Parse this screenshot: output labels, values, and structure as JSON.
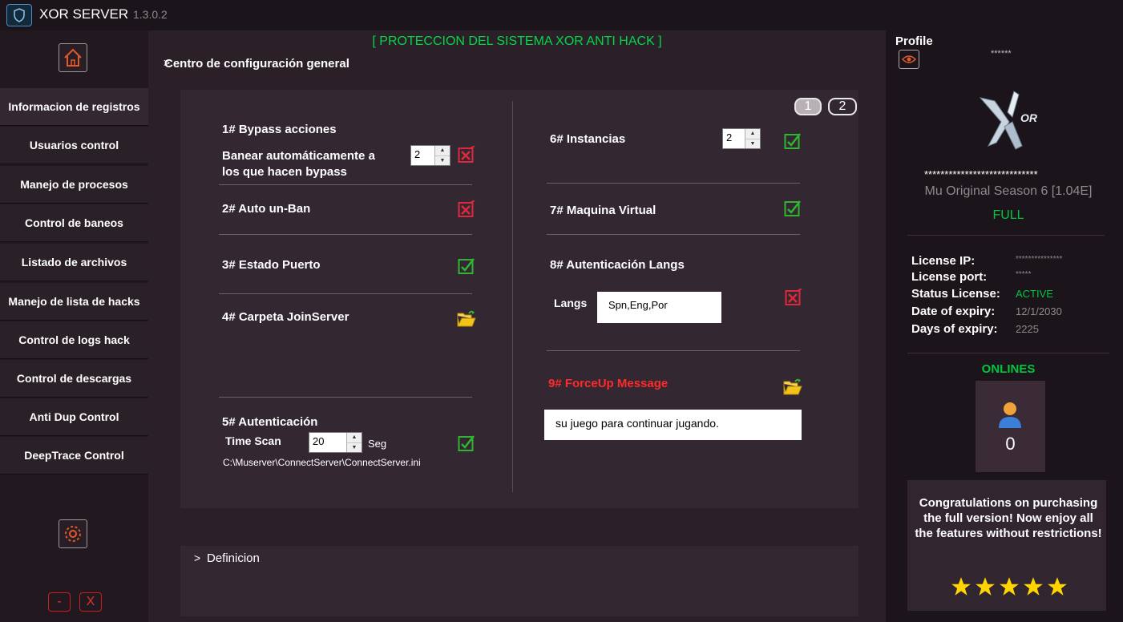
{
  "app": {
    "title": "XOR SERVER",
    "version": "1.3.0.2"
  },
  "sidebar": {
    "items": [
      {
        "label": "Informacion de registros"
      },
      {
        "label": "Usuarios control"
      },
      {
        "label": "Manejo de procesos"
      },
      {
        "label": "Control de baneos"
      },
      {
        "label": "Listado de archivos"
      },
      {
        "label": "Manejo de lista de hacks"
      },
      {
        "label": "Control de logs hack"
      },
      {
        "label": "Control de descargas"
      },
      {
        "label": "Anti Dup Control"
      },
      {
        "label": "DeepTrace Control"
      }
    ],
    "minimize_label": "-",
    "close_label": "X"
  },
  "main": {
    "banner": "[ PROTECCION DEL SISTEMA XOR ANTI HACK ]",
    "section_title": "Centro de configuración general",
    "chevron": ">",
    "pages": [
      "1",
      "2"
    ],
    "left": {
      "bypass": {
        "title": "1# Bypass acciones",
        "line1": "Banear automáticamente a",
        "line2": "los que hacen bypass",
        "value": "2"
      },
      "autounban": {
        "title": "2# Auto un-Ban"
      },
      "puerto": {
        "title": "3# Estado Puerto"
      },
      "joinserver": {
        "title": "4# Carpeta JoinServer"
      },
      "auth": {
        "title": "5# Autenticación",
        "time_label": "Time Scan",
        "time_value": "20",
        "unit": "Seg",
        "path": "C:\\Muserver\\ConnectServer\\ConnectServer.ini"
      }
    },
    "right": {
      "instancias": {
        "title": "6# Instancias",
        "value": "2"
      },
      "maquina": {
        "title": "7# Maquina Virtual"
      },
      "langs": {
        "title": "8# Autenticación Langs",
        "label": "Langs",
        "value": "Spn,Eng,Por"
      },
      "forceup": {
        "title": "9# ForceUp Message",
        "message": "su juego para continuar jugando."
      }
    },
    "definicion": "Definicion"
  },
  "profile": {
    "title": "Profile",
    "masked_name": "******",
    "masked_key": "****************************",
    "server_name": "Mu Original Season 6 [1.04E]",
    "edition": "FULL",
    "license": [
      {
        "label": "License IP:",
        "value": "***************"
      },
      {
        "label": "License port:",
        "value": "*****"
      },
      {
        "label": "Status License:",
        "value": "ACTIVE"
      },
      {
        "label": "Date of expiry:",
        "value": "12/1/2030"
      },
      {
        "label": "Days of expiry:",
        "value": "2225"
      }
    ],
    "onlines_title": "ONLINES",
    "onlines_count": "0",
    "congrats": "Congratulations on purchasing the full version! Now enjoy all the features without restrictions!",
    "stars": 5
  },
  "colors": {
    "accent_green": "#00d84a",
    "check_green": "#2fb52f",
    "cross_red": "#e0283c",
    "star": "#ffd400"
  }
}
